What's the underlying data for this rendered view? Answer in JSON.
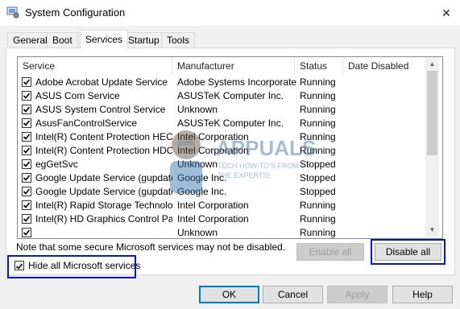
{
  "window": {
    "title": "System Configuration"
  },
  "tabs": [
    "General",
    "Boot",
    "Services",
    "Startup",
    "Tools"
  ],
  "active_tab": "Services",
  "columns": [
    "Service",
    "Manufacturer",
    "Status",
    "Date Disabled"
  ],
  "services": [
    {
      "name": "Adobe Acrobat Update Service",
      "manufacturer": "Adobe Systems Incorporated",
      "status": "Running",
      "date_disabled": "",
      "checked": true
    },
    {
      "name": "ASUS Com Service",
      "manufacturer": "ASUSTeK Computer Inc.",
      "status": "Running",
      "date_disabled": "",
      "checked": true
    },
    {
      "name": "ASUS System Control Service",
      "manufacturer": "Unknown",
      "status": "Running",
      "date_disabled": "",
      "checked": true
    },
    {
      "name": "AsusFanControlService",
      "manufacturer": "ASUSTeK Computer Inc.",
      "status": "Running",
      "date_disabled": "",
      "checked": true
    },
    {
      "name": "Intel(R) Content Protection HEC...",
      "manufacturer": "Intel Corporation",
      "status": "Running",
      "date_disabled": "",
      "checked": true
    },
    {
      "name": "Intel(R) Content Protection HDC...",
      "manufacturer": "Intel Corporation",
      "status": "Running",
      "date_disabled": "",
      "checked": true
    },
    {
      "name": "egGetSvc",
      "manufacturer": "Unknown",
      "status": "Stopped",
      "date_disabled": "",
      "checked": true
    },
    {
      "name": "Google Update Service (gupdate)",
      "manufacturer": "Google Inc.",
      "status": "Stopped",
      "date_disabled": "",
      "checked": true
    },
    {
      "name": "Google Update Service (gupdatem)",
      "manufacturer": "Google Inc.",
      "status": "Stopped",
      "date_disabled": "",
      "checked": true
    },
    {
      "name": "Intel(R) Rapid Storage Technology",
      "manufacturer": "Intel Corporation",
      "status": "Running",
      "date_disabled": "",
      "checked": true
    },
    {
      "name": "Intel(R) HD Graphics Control Pa...",
      "manufacturer": "Intel Corporation",
      "status": "Running",
      "date_disabled": "",
      "checked": true
    },
    {
      "name": "",
      "manufacturer": "Unknown",
      "status": "Running",
      "date_disabled": "",
      "checked": true
    }
  ],
  "watermark": {
    "brand": "APPUALS",
    "tagline_1": "TECH HOW-TO'S FROM",
    "tagline_2": "THE EXPERTS!"
  },
  "note": "Note that some secure Microsoft services may not be disabled.",
  "buttons": {
    "enable_all": "Enable all",
    "disable_all": "Disable all",
    "ok": "OK",
    "cancel": "Cancel",
    "apply": "Apply",
    "help": "Help"
  },
  "hide_ms": {
    "label": "Hide all Microsoft services",
    "checked": true
  },
  "colors": {
    "highlight": "#0a14c8",
    "check": "#000000"
  },
  "icons": {
    "close": "close-icon",
    "app": "system-config-icon",
    "check": "check-icon"
  }
}
